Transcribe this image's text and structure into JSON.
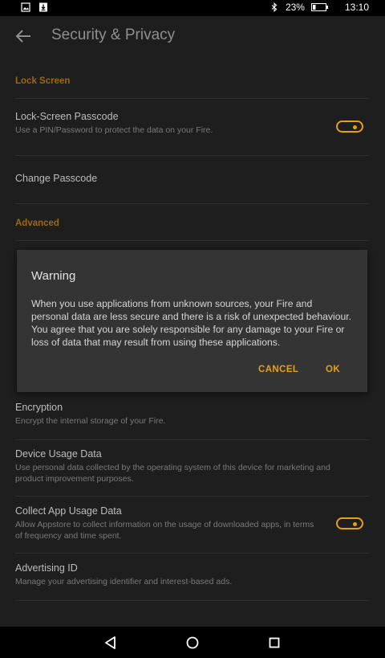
{
  "status_bar": {
    "icons_left": [
      "image-notification-icon",
      "download-notification-icon"
    ],
    "bluetooth_icon": "bluetooth-icon",
    "battery_percent": "23%",
    "battery_level": 0.23,
    "time": "13:10"
  },
  "header": {
    "title": "Security & Privacy"
  },
  "sections": {
    "lock_screen": "Lock Screen",
    "advanced": "Advanced"
  },
  "items": {
    "passcode": {
      "title": "Lock-Screen Passcode",
      "subtitle": "Use a PIN/Password to protect the data on your Fire.",
      "toggle_on": true
    },
    "change_passcode": {
      "title": "Change Passcode"
    },
    "encryption": {
      "title": "Encryption",
      "subtitle": "Encrypt the internal storage of your Fire."
    },
    "device_usage": {
      "title": "Device Usage Data",
      "subtitle": "Use personal data collected by the operating system of this device for marketing and product improvement purposes."
    },
    "app_usage": {
      "title": "Collect App Usage Data",
      "subtitle": "Allow Appstore to collect information on the usage of downloaded apps, in terms of frequency and time spent.",
      "toggle_on": true
    },
    "advertising": {
      "title": "Advertising ID",
      "subtitle": "Manage your advertising identifier and interest-based ads."
    }
  },
  "dialog": {
    "title": "Warning",
    "message": "When you use applications from unknown sources, your Fire and personal data are less secure and there is a risk of unexpected behaviour. You agree that you are solely responsible for any damage to your Fire or loss of data that may result from using these applications.",
    "cancel_label": "CANCEL",
    "ok_label": "OK"
  },
  "colors": {
    "accent": "#e6a015",
    "section_header": "#9a6a13",
    "background": "#1e1e1e",
    "dialog": "#343434"
  }
}
